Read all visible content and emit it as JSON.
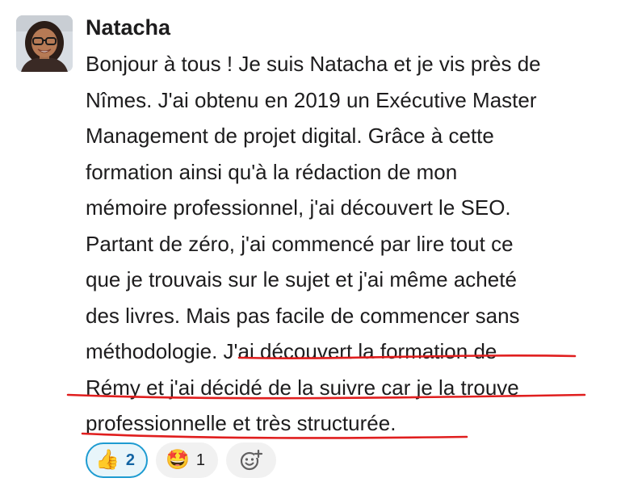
{
  "message": {
    "author": "Natacha",
    "avatar_icon": "user-avatar-photo",
    "lines": [
      "Bonjour à tous ! Je suis Natacha et je vis près de",
      "Nîmes. J'ai obtenu en 2019 un Exécutive Master",
      "Management de projet digital. Grâce à cette",
      "formation ainsi qu'à la rédaction de mon",
      "mémoire professionnel, j'ai découvert le SEO.",
      "Partant de zéro, j'ai commencé par lire tout ce",
      "que je trouvais sur le sujet et j'ai même acheté",
      "des livres. Mais pas facile de commencer sans",
      "méthodologie. J'ai découvert la formation de",
      "Rémy et j'ai décidé de la suivre car je la trouve",
      "professionnelle et très structurée."
    ],
    "highlight_color": "#e01e1e"
  },
  "reactions": [
    {
      "emoji": "👍",
      "emoji_name": "thumbs-up-icon",
      "count": "2",
      "active": true
    },
    {
      "emoji": "🤩",
      "emoji_name": "star-struck-icon",
      "count": "1",
      "active": false
    }
  ],
  "add_reaction_icon": "add-reaction-icon",
  "colors": {
    "active_border": "#1d9bd1",
    "active_bg": "#e8f5fa",
    "active_text": "#1264a3",
    "pill_bg": "#f1f1f1"
  }
}
